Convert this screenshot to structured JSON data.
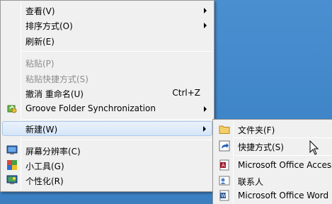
{
  "context_menu": {
    "items": [
      {
        "label": "查看(V)",
        "has_submenu": true
      },
      {
        "label": "排序方式(O)",
        "has_submenu": true
      },
      {
        "label": "刷新(E)"
      },
      {
        "label": "粘贴(P)",
        "disabled": true
      },
      {
        "label": "粘贴快捷方式(S)",
        "disabled": true
      },
      {
        "label": "撤消 重命名(U)",
        "shortcut": "Ctrl+Z"
      },
      {
        "label": "Groove Folder Synchronization",
        "has_submenu": true,
        "icon": "groove-sync-icon"
      },
      {
        "label": "新建(W)",
        "has_submenu": true,
        "active": true
      },
      {
        "label": "屏幕分辨率(C)",
        "icon": "screen-resolution-icon"
      },
      {
        "label": "小工具(G)",
        "icon": "gadgets-icon"
      },
      {
        "label": "个性化(R)",
        "icon": "personalize-icon"
      }
    ]
  },
  "new_submenu": {
    "items": [
      {
        "label": "文件夹(F)",
        "icon": "folder-icon"
      },
      {
        "label": "快捷方式(S)",
        "icon": "shortcut-icon",
        "highlighted": true
      },
      {
        "label": "Microsoft Office Access",
        "icon": "access-icon"
      },
      {
        "label": "联系人",
        "icon": "contact-icon"
      },
      {
        "label": "Microsoft Office Word",
        "icon": "word-icon"
      }
    ]
  },
  "colors": {
    "desktop": "#3d7fc2",
    "menu_bg": "#f0f0f0",
    "highlight": "#7be07b"
  }
}
